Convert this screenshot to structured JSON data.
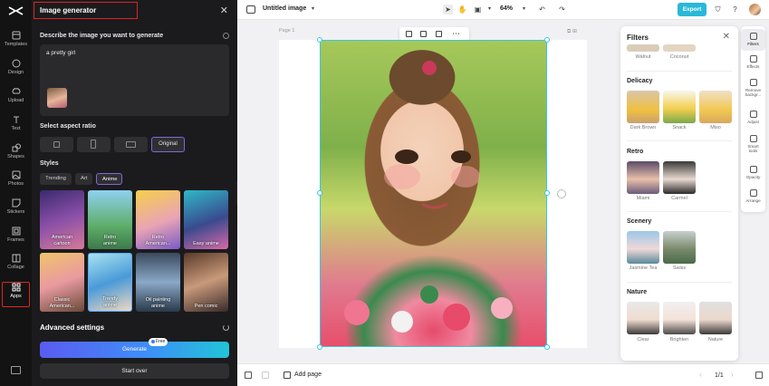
{
  "rail": {
    "items": [
      {
        "label": "Templates"
      },
      {
        "label": "Design"
      },
      {
        "label": "Upload"
      },
      {
        "label": "Text"
      },
      {
        "label": "Shapes"
      },
      {
        "label": "Photos"
      },
      {
        "label": "Stickers"
      },
      {
        "label": "Frames"
      },
      {
        "label": "Collage"
      },
      {
        "label": "Apps"
      }
    ],
    "active": "Apps"
  },
  "generator": {
    "title": "Image generator",
    "describe_label": "Describe the image you want to generate",
    "prompt_value": "a pretty girl",
    "aspect_label": "Select aspect ratio",
    "aspect_selected": "Original",
    "styles_label": "Styles",
    "style_tabs": [
      "Trending",
      "Art",
      "Anime"
    ],
    "style_tab_active": "Anime",
    "styles": [
      {
        "name": "American cartoon",
        "line1": "American",
        "line2": "cartoon"
      },
      {
        "name": "Retro anime",
        "line1": "Retro",
        "line2": "anime"
      },
      {
        "name": "Retro American...",
        "line1": "Retro",
        "line2": "American..."
      },
      {
        "name": "Easy anime",
        "line1": "Easy anime",
        "line2": ""
      },
      {
        "name": "Classic American...",
        "line1": "Classic",
        "line2": "American..."
      },
      {
        "name": "Trendy anime",
        "line1": "Trendy",
        "line2": "anime"
      },
      {
        "name": "Oil painting anime",
        "line1": "Oil painting",
        "line2": "anime"
      },
      {
        "name": "Pen comic",
        "line1": "Pen comic",
        "line2": ""
      }
    ],
    "style_selected": "Trendy anime",
    "advanced_label": "Advanced settings",
    "generate_label": "Generate",
    "free_badge": "Free",
    "start_over_label": "Start over"
  },
  "topbar": {
    "doc_title": "Untitled image",
    "zoom": "64%",
    "export_label": "Export"
  },
  "canvas": {
    "page_label": "Page 1"
  },
  "bottombar": {
    "add_page_label": "Add page",
    "pager": "1/1"
  },
  "filters": {
    "title": "Filters",
    "top_row": [
      "Walnut",
      "Coconut"
    ],
    "groups": [
      {
        "name": "Delicacy",
        "items": [
          "Dark Brown",
          "Snack",
          "Miso"
        ]
      },
      {
        "name": "Retro",
        "items": [
          "Miami",
          "Carmel"
        ]
      },
      {
        "name": "Scenery",
        "items": [
          "Jasmine Tea",
          "Swiss"
        ]
      },
      {
        "name": "Nature",
        "items": [
          "Clear",
          "Brighten",
          "Nature"
        ]
      }
    ]
  },
  "right_tools": [
    {
      "line1": "Filters",
      "line2": ""
    },
    {
      "line1": "Effects",
      "line2": ""
    },
    {
      "line1": "Remove",
      "line2": "backgr..."
    },
    {
      "line1": "Adjust",
      "line2": ""
    },
    {
      "line1": "Smart",
      "line2": "tools"
    },
    {
      "line1": "Opacity",
      "line2": ""
    },
    {
      "line1": "Arrange",
      "line2": ""
    }
  ],
  "colors": {
    "accent": "#2ab8d9",
    "selection": "#37c6e8",
    "highlight_box": "#e02424",
    "panel_bg": "#1b1b1d"
  }
}
